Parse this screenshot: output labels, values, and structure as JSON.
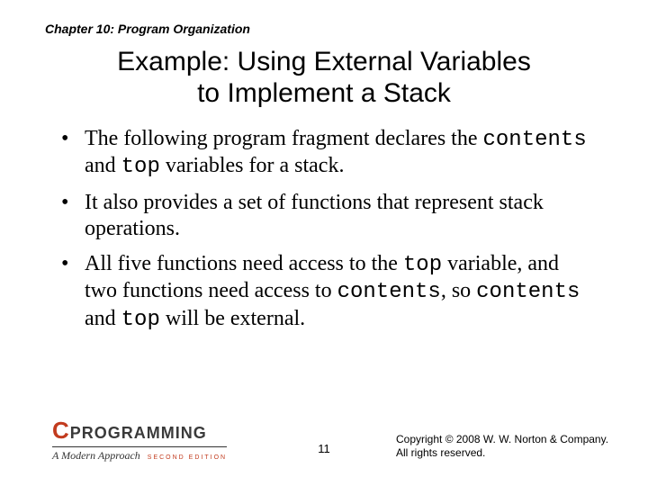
{
  "chapter_label": "Chapter 10: Program Organization",
  "title_line1": "Example: Using External Variables",
  "title_line2": "to Implement a Stack",
  "bullets": [
    {
      "pre1": "The following program fragment declares the ",
      "code1": "contents",
      "mid1": " and ",
      "code2": "top",
      "post1": " variables for a stack."
    },
    {
      "pre1": "It also provides a set of functions that represent stack operations."
    },
    {
      "pre1": "All five functions need access to the ",
      "code1": "top",
      "mid1": " variable, and two functions need access to ",
      "code2": "contents",
      "mid2": ", so ",
      "code3": "contents",
      "mid3": " and ",
      "code4": "top",
      "post1": " will be external."
    }
  ],
  "logo": {
    "c": "C",
    "word": "PROGRAMMING",
    "tagline": "A Modern Approach",
    "edition": "SECOND EDITION"
  },
  "page_number": "11",
  "copyright_line1": "Copyright © 2008 W. W. Norton & Company.",
  "copyright_line2": "All rights reserved."
}
